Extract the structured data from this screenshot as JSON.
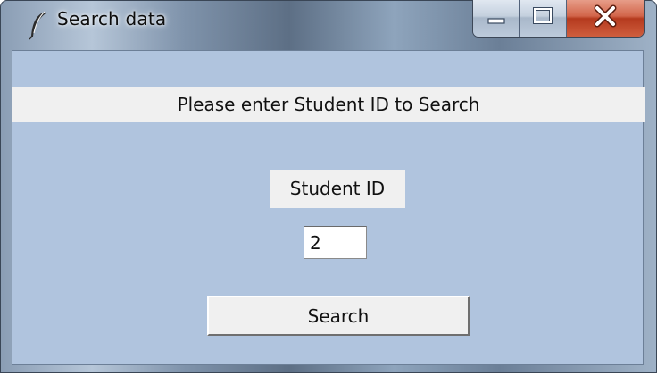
{
  "window": {
    "title": "Search data"
  },
  "icons": {
    "app": "feather-icon",
    "minimize": "minimize-icon",
    "maximize": "maximize-icon",
    "close": "close-icon"
  },
  "form": {
    "banner_text": "Please enter Student ID to Search",
    "id_label": "Student ID",
    "id_value": "2",
    "search_label": "Search"
  },
  "colors": {
    "client_bg": "#b0c4de",
    "label_bg": "#f0f0f0",
    "close_button": "#c8452a"
  }
}
